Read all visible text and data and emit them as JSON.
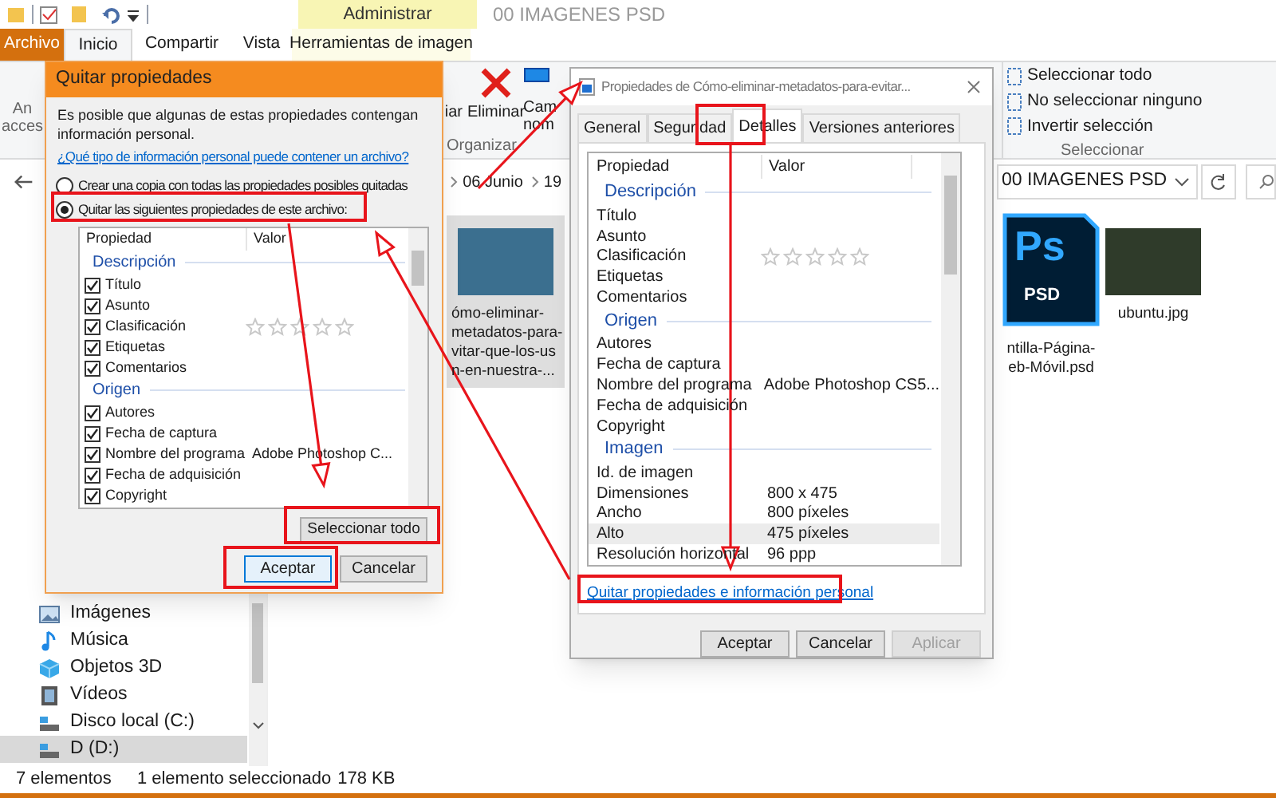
{
  "explorer": {
    "contextual_group": "Administrar",
    "title": "00 IMAGENES PSD",
    "tabs": [
      {
        "label": "Archivo",
        "kind": "file",
        "selected": false
      },
      {
        "label": "Inicio",
        "kind": "tab",
        "selected": true
      },
      {
        "label": "Compartir",
        "kind": "tab",
        "selected": false
      },
      {
        "label": "Vista",
        "kind": "tab",
        "selected": false
      },
      {
        "label": "Herramientas de imagen",
        "kind": "contextual",
        "selected": false
      }
    ],
    "ribbon": {
      "left_partial": [
        "An",
        "acces"
      ],
      "copy_partial": "iar",
      "delete": "Eliminar",
      "rename_partial": [
        "Cam",
        "nom"
      ],
      "organize_group": "Organizar",
      "select_items": [
        "Seleccionar todo",
        "No seleccionar ninguno",
        "Invertir selección"
      ],
      "select_group": "Seleccionar"
    },
    "breadcrumbs": [
      "06 Junio",
      "19"
    ],
    "address": "00 IMAGENES PSD",
    "sidebar": [
      {
        "label": "Imágenes",
        "kind": "pictures",
        "selected": false
      },
      {
        "label": "Música",
        "kind": "music",
        "selected": false
      },
      {
        "label": "Objetos 3D",
        "kind": "objects",
        "selected": false
      },
      {
        "label": "Vídeos",
        "kind": "videos",
        "selected": false
      },
      {
        "label": "Disco local (C:)",
        "kind": "drive",
        "selected": false
      },
      {
        "label": "D (D:)",
        "kind": "drive",
        "selected": true
      }
    ],
    "files": [
      {
        "kind": "photo",
        "name_lines": [
          "ómo-eliminar-",
          "metadatos-para-",
          "vitar-que-los-us",
          "n-en-nuestra-..."
        ],
        "selected": true
      },
      {
        "kind": "psd",
        "icon_label": "Ps",
        "icon_sublabel": "PSD",
        "name_lines": [
          "ntilla-Página-",
          "eb-Móvil.psd"
        ],
        "selected": false
      },
      {
        "kind": "photo",
        "name_lines": [
          "ubuntu.jpg"
        ],
        "selected": false
      }
    ],
    "status": [
      "7 elementos",
      "1 elemento seleccionado",
      "178 KB"
    ]
  },
  "remove_dialog": {
    "title": "Quitar propiedades",
    "text": "Es posible que algunas de estas propiedades contengan información personal.",
    "link": "¿Qué tipo de información personal puede contener un archivo?",
    "options": [
      {
        "label": "Crear una copia con todas las propiedades posibles quitadas",
        "selected": false
      },
      {
        "label": "Quitar las siguientes propiedades de este archivo:",
        "selected": true
      }
    ],
    "columns": [
      "Propiedad",
      "Valor"
    ],
    "groups": [
      {
        "title": "Descripción",
        "rows": [
          {
            "label": "Título",
            "checked": true
          },
          {
            "label": "Asunto",
            "checked": true
          },
          {
            "label": "Clasificación",
            "checked": true,
            "stars": 0
          },
          {
            "label": "Etiquetas",
            "checked": true
          },
          {
            "label": "Comentarios",
            "checked": true
          }
        ]
      },
      {
        "title": "Origen",
        "rows": [
          {
            "label": "Autores",
            "checked": true
          },
          {
            "label": "Fecha de captura",
            "checked": true
          },
          {
            "label": "Nombre del programa",
            "value": "Adobe Photoshop C...",
            "checked": true
          },
          {
            "label": "Fecha de adquisición",
            "checked": true
          },
          {
            "label": "Copyright",
            "checked": true
          }
        ]
      }
    ],
    "select_all": "Seleccionar todo",
    "buttons": [
      {
        "label": "Aceptar",
        "default": true
      },
      {
        "label": "Cancelar",
        "default": false
      }
    ]
  },
  "properties_dialog": {
    "title": "Propiedades de Cómo-eliminar-metadatos-para-evitar...",
    "tabs": [
      {
        "label": "General",
        "selected": false
      },
      {
        "label": "Seguridad",
        "selected": false
      },
      {
        "label": "Detalles",
        "selected": true
      },
      {
        "label": "Versiones anteriores",
        "selected": false
      }
    ],
    "columns": [
      "Propiedad",
      "Valor"
    ],
    "groups": [
      {
        "title": "Descripción",
        "rows": [
          {
            "label": "Título",
            "selected": false
          },
          {
            "label": "Asunto",
            "selected": false
          },
          {
            "label": "Clasificación",
            "stars": 0,
            "selected": false
          },
          {
            "label": "Etiquetas",
            "selected": false
          },
          {
            "label": "Comentarios",
            "selected": false
          }
        ]
      },
      {
        "title": "Origen",
        "rows": [
          {
            "label": "Autores",
            "selected": false
          },
          {
            "label": "Fecha de captura",
            "selected": false
          },
          {
            "label": "Nombre del programa",
            "value": "Adobe Photoshop CS5...",
            "selected": false
          },
          {
            "label": "Fecha de adquisición",
            "selected": false
          },
          {
            "label": "Copyright",
            "selected": false
          }
        ]
      },
      {
        "title": "Imagen",
        "rows": [
          {
            "label": "Id. de imagen",
            "selected": false
          },
          {
            "label": "Dimensiones",
            "value": "800 x 475",
            "selected": false
          },
          {
            "label": "Ancho",
            "value": "800 píxeles",
            "selected": false
          },
          {
            "label": "Alto",
            "value": "475 píxeles",
            "selected": true
          },
          {
            "label": "Resolución horizontal",
            "value": "96 ppp",
            "selected": false
          }
        ]
      }
    ],
    "link": "Quitar propiedades e información personal",
    "buttons": [
      {
        "label": "Aceptar",
        "disabled": false
      },
      {
        "label": "Cancelar",
        "disabled": false
      },
      {
        "label": "Aplicar",
        "disabled": true
      }
    ]
  }
}
